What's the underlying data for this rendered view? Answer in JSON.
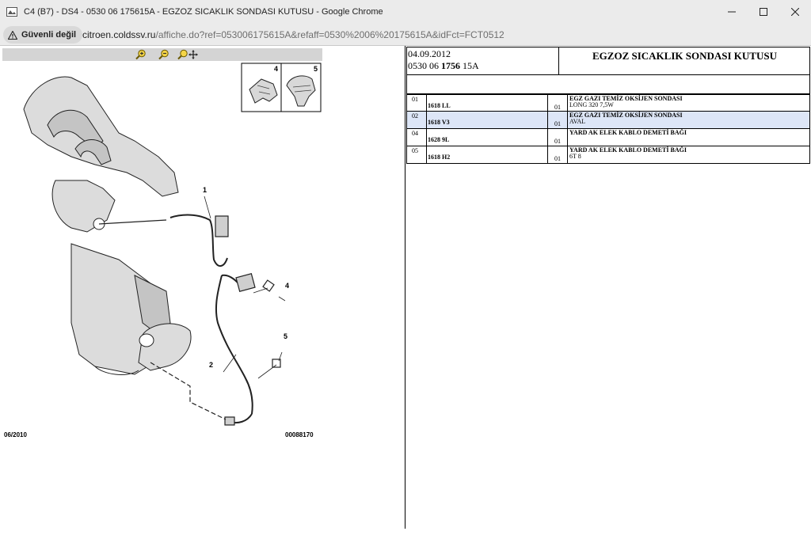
{
  "browser": {
    "window_title": "C4 (B7) - DS4 - 0530 06 175615A - EGZOZ SICAKLIK SONDASI KUTUSU - Google Chrome",
    "security_label": "Güvenli değil",
    "url_host": "citroen.coldssv.ru",
    "url_path": "/affiche.do?ref=053006175615A&refaff=0530%2006%20175615A&idFct=FCT0512",
    "icons": {
      "app": "page-icon",
      "security": "warning-triangle-icon",
      "minimize": "minimize-icon",
      "maximize": "maximize-icon",
      "close": "close-icon"
    }
  },
  "diagram": {
    "toolbar_icons": [
      "zoom-in-icon",
      "zoom-out-icon",
      "zoom-pan-icon"
    ],
    "callouts": [
      "1",
      "2",
      "4",
      "5"
    ],
    "inset_labels": [
      "4",
      "5"
    ],
    "date": "06/2010",
    "ref": "00088170"
  },
  "header": {
    "date": "04.09.2012",
    "ref_prefix": "0530 06 ",
    "ref_bold": "1756",
    "ref_suffix": " 15A",
    "title": "EGZOZ SICAKLIK SONDASI KUTUSU"
  },
  "parts": [
    {
      "index": "01",
      "ref": "1618 LL",
      "qty": "01",
      "desc1": "EGZ GAZI TEMİZ OKSİJEN SONDASI",
      "desc2": "LONG 320 7,5W",
      "selected": false
    },
    {
      "index": "02",
      "ref": "1618 V3",
      "qty": "01",
      "desc1": "EGZ GAZI TEMİZ OKSİJEN SONDASI",
      "desc2": "AVAL",
      "selected": true
    },
    {
      "index": "04",
      "ref": "1628 9L",
      "qty": "01",
      "desc1": "YARD AK ELEK KABLO DEMETİ BAĞI",
      "desc2": "",
      "selected": false
    },
    {
      "index": "05",
      "ref": "1618 H2",
      "qty": "01",
      "desc1": "YARD AK ELEK KABLO DEMETİ BAĞI",
      "desc2": "6T 8",
      "selected": false
    }
  ],
  "colors": {
    "chrome_frame": "#ebebeb",
    "selected_row": "#dde6f7",
    "zoom_toolbar": "#d4d4d4"
  }
}
